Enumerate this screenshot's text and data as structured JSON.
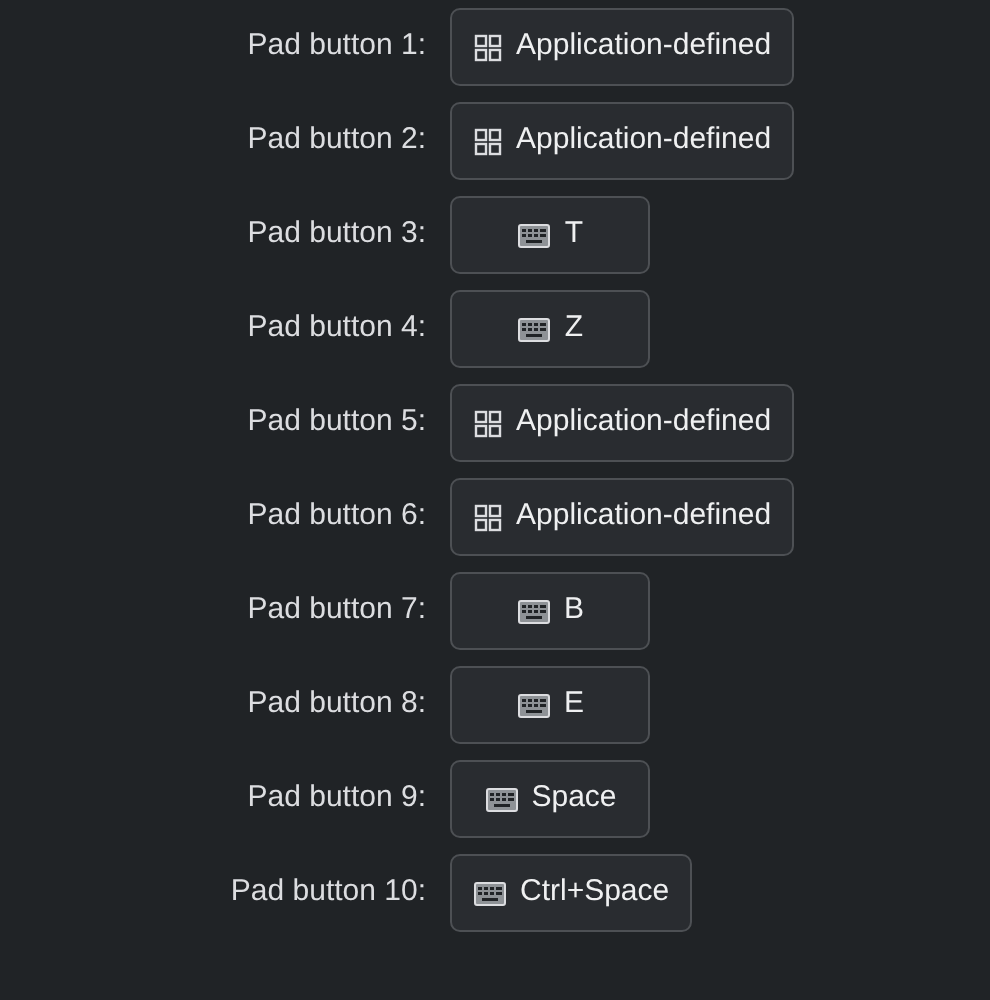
{
  "pad_buttons": [
    {
      "label": "Pad button 1:",
      "kind": "app",
      "value": "Application-defined"
    },
    {
      "label": "Pad button 2:",
      "kind": "app",
      "value": "Application-defined"
    },
    {
      "label": "Pad button 3:",
      "kind": "key",
      "value": "T"
    },
    {
      "label": "Pad button 4:",
      "kind": "key",
      "value": "Z"
    },
    {
      "label": "Pad button 5:",
      "kind": "app",
      "value": "Application-defined"
    },
    {
      "label": "Pad button 6:",
      "kind": "app",
      "value": "Application-defined"
    },
    {
      "label": "Pad button 7:",
      "kind": "key",
      "value": "B"
    },
    {
      "label": "Pad button 8:",
      "kind": "key",
      "value": "E"
    },
    {
      "label": "Pad button 9:",
      "kind": "key",
      "value": "Space"
    },
    {
      "label": "Pad button 10:",
      "kind": "key",
      "value": "Ctrl+Space"
    }
  ]
}
